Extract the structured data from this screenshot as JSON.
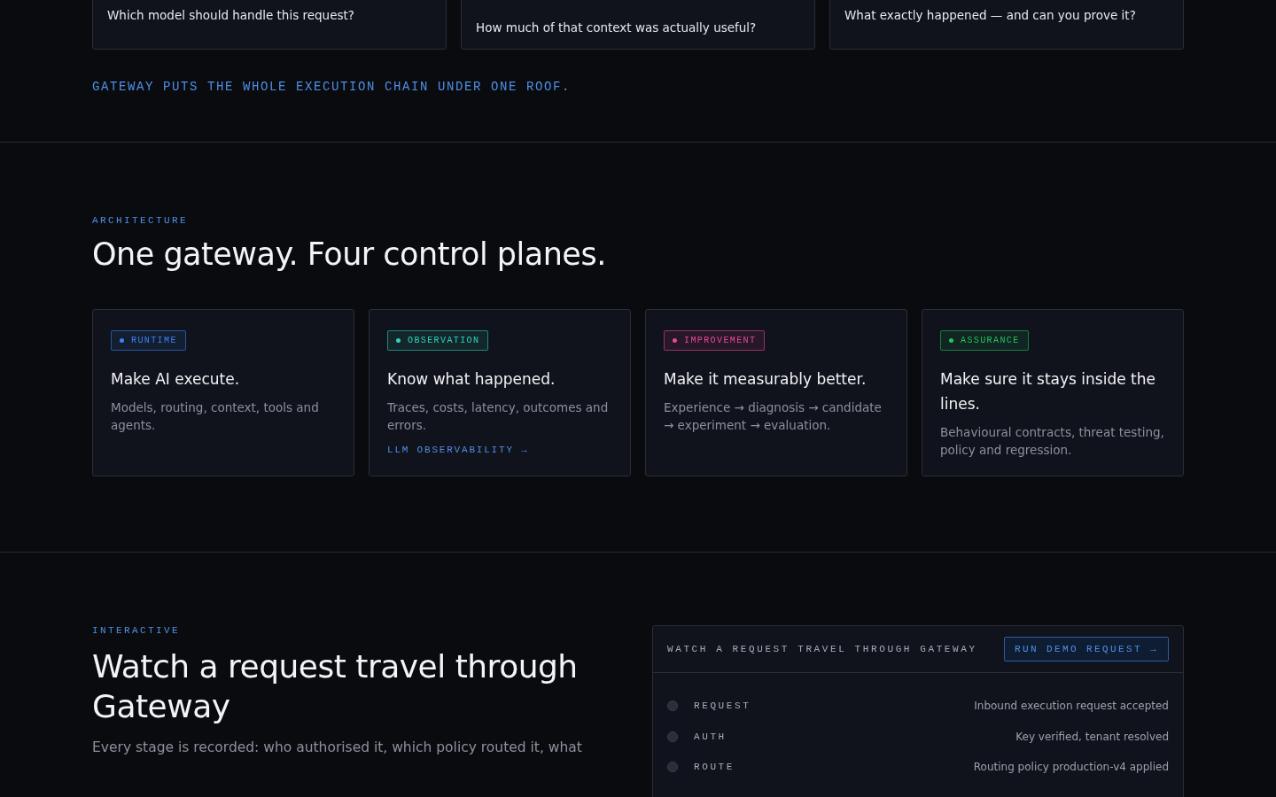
{
  "questions": [
    {
      "text": "Which model should handle this request?"
    },
    {
      "text": "How much of that context was actually useful?"
    },
    {
      "text": "What exactly happened — and can you prove it?"
    }
  ],
  "tagline": "GATEWAY PUTS THE WHOLE EXECUTION CHAIN UNDER ONE ROOF.",
  "architecture": {
    "eyebrow": "ARCHITECTURE",
    "heading": "One gateway. Four control planes.",
    "planes": [
      {
        "tag": "RUNTIME",
        "color": "#3b82f6",
        "title": "Make AI execute.",
        "body": "Models, routing, context, tools and agents."
      },
      {
        "tag": "OBSERVATION",
        "color": "#2dd4bf",
        "title": "Know what happened.",
        "body": "Traces, costs, latency, outcomes and errors.",
        "link": "LLM OBSERVABILITY →"
      },
      {
        "tag": "IMPROVEMENT",
        "color": "#ec4899",
        "title": "Make it measurably better.",
        "body": "Experience → diagnosis → candidate → experiment → evaluation."
      },
      {
        "tag": "ASSURANCE",
        "color": "#22c55e",
        "title": "Make sure it stays inside the lines.",
        "body": "Behavioural contracts, threat testing, policy and regression."
      }
    ]
  },
  "interactive": {
    "eyebrow": "INTERACTIVE",
    "heading": "Watch a request travel through Gateway",
    "body": "Every stage is recorded: who authorised it, which policy routed it, what",
    "panel": {
      "title": "WATCH A REQUEST TRAVEL THROUGH GATEWAY",
      "button": "RUN DEMO REQUEST →",
      "stages": [
        {
          "name": "REQUEST",
          "detail": "Inbound execution request accepted"
        },
        {
          "name": "AUTH",
          "detail": "Key verified, tenant resolved"
        },
        {
          "name": "ROUTE",
          "detail": "Routing policy production-v4 applied"
        }
      ]
    }
  }
}
